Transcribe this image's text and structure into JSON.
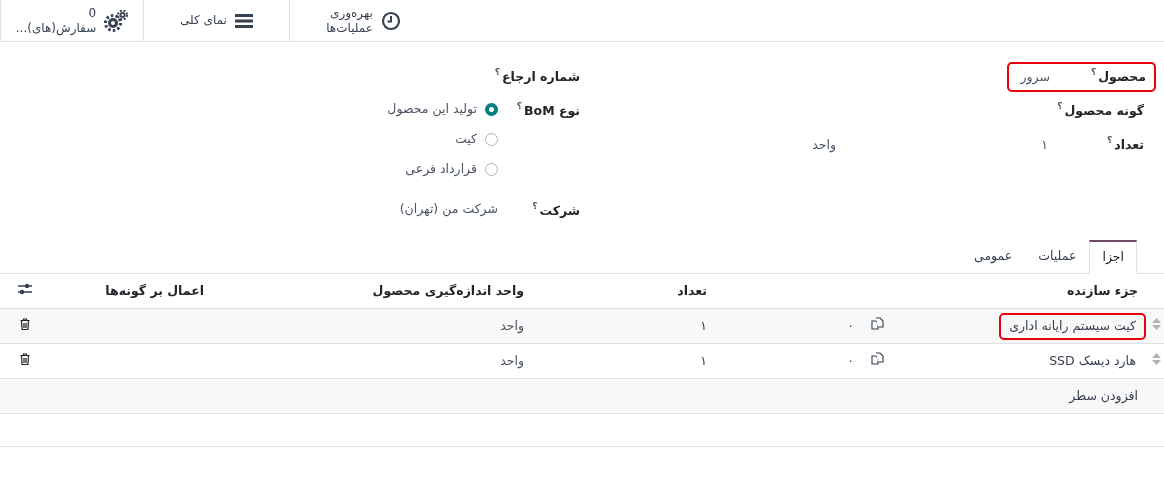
{
  "smart_buttons": [
    {
      "lines": [
        "بهره‌وری",
        "عملیات‌ها"
      ]
    },
    {
      "lines": [
        "نمای کلی"
      ]
    },
    {
      "lines": [
        "0",
        "سفارش(های)..."
      ]
    }
  ],
  "form": {
    "right": [
      {
        "label": "محصول",
        "help": "؟",
        "value": "سرور",
        "highlighted": true
      },
      {
        "label": "گونه محصول",
        "help": "؟",
        "highlighted": false
      },
      {
        "label": "تعداد",
        "help": "؟",
        "value": "۱",
        "unit": "واحد",
        "highlighted": false
      }
    ],
    "left": [
      {
        "label": "شماره ارجاع",
        "help": "؟"
      },
      {
        "label": "نوع BoM",
        "help": "؟",
        "options": [
          {
            "label": "تولید این محصول",
            "selected": true
          },
          {
            "label": "کیت",
            "selected": false
          },
          {
            "label": "قرارداد فرعی",
            "selected": false
          }
        ]
      },
      {
        "label": "شرکت",
        "help": "؟",
        "value": "شرکت من (تهران)"
      }
    ]
  },
  "tabs": [
    {
      "label": "اجزا",
      "selected": true
    },
    {
      "label": "عملیات",
      "selected": false
    },
    {
      "label": "عمومی",
      "selected": false
    }
  ],
  "table": {
    "columns": [
      "جزء سازنده",
      "تعداد",
      "واحد اندازه‌گیری محصول",
      "اعمال بر گونه‌ها"
    ],
    "rows": [
      {
        "component": "کیت سیستم رایانه اداری",
        "highlighted": true,
        "availability": "۰",
        "quantity": "۱",
        "uom": "واحد"
      },
      {
        "component": "هارد دیسک SSD",
        "highlighted": false,
        "availability": "۰",
        "quantity": "۱",
        "uom": "واحد"
      }
    ],
    "add_line": "افزودن سطر"
  }
}
